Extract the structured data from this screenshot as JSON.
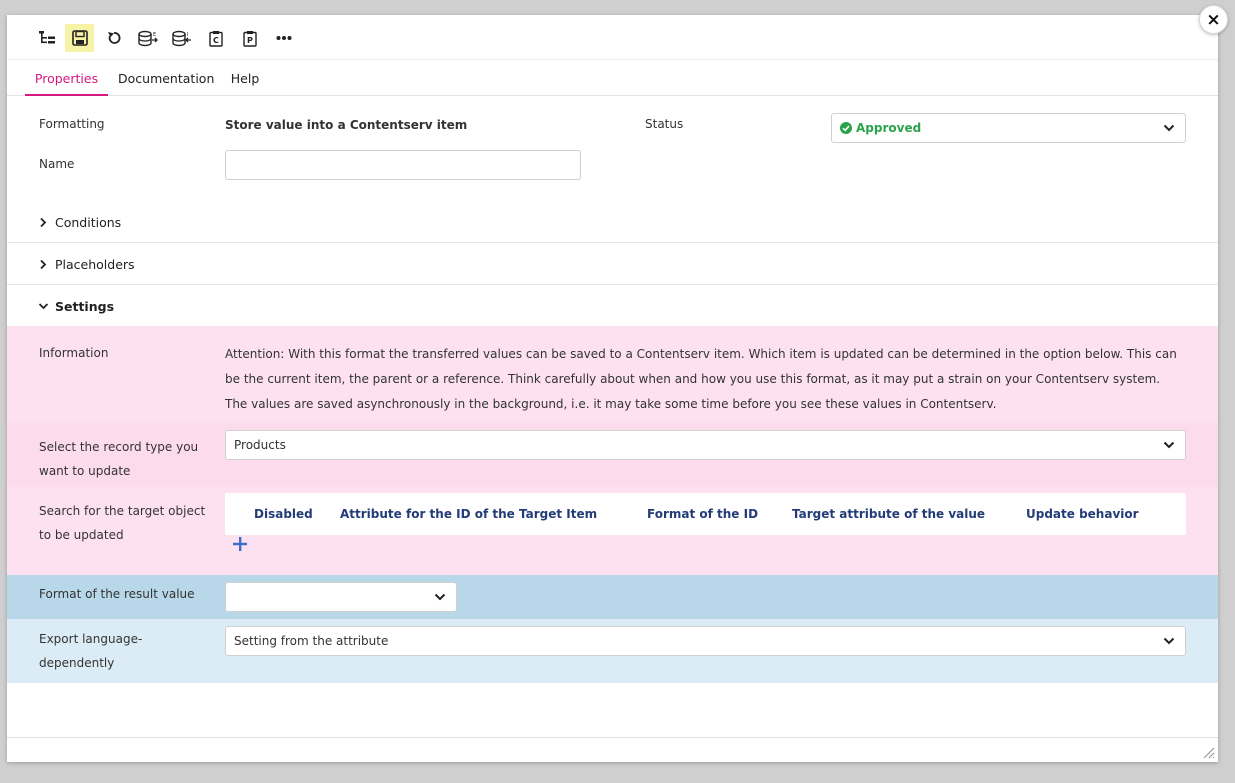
{
  "toolbar": {
    "buttons": [
      {
        "name": "tree-view-icon"
      },
      {
        "name": "save-icon",
        "active": true
      },
      {
        "name": "undo-icon"
      },
      {
        "name": "database-export-icon"
      },
      {
        "name": "database-import-icon"
      },
      {
        "name": "clipboard-c-icon"
      },
      {
        "name": "clipboard-p-icon"
      },
      {
        "name": "more-icon"
      }
    ]
  },
  "close_label": "×",
  "tabs": [
    {
      "label": "Properties",
      "active": true
    },
    {
      "label": "Documentation",
      "active": false
    },
    {
      "label": "Help",
      "active": false
    }
  ],
  "general": {
    "formatting_label": "Formatting",
    "formatting_value": "Store value into a Contentserv item",
    "status_label": "Status",
    "status_value": "Approved",
    "name_label": "Name",
    "name_value": ""
  },
  "sections": {
    "conditions": "Conditions",
    "placeholders": "Placeholders",
    "settings": "Settings"
  },
  "settings": {
    "information_label": "Information",
    "information_text": "Attention: With this format the transferred values can be saved to a Contentserv item. Which item is updated can be determined in the option below. This can be the current item, the parent or a reference. Think carefully about when and how you use this format, as it may put a strain on your Contentserv system. The values are saved asynchronously in the background, i.e. it may take some time before you see these values in Contentserv.",
    "record_type_label": "Select the record type you want to update",
    "record_type_value": "Products",
    "search_target_label": "Search for the target object to be updated",
    "table_headers": [
      "Disabled",
      "Attribute for the ID of the Target Item",
      "Format of the ID",
      "Target attribute of the value",
      "Update behavior"
    ],
    "format_result_label": "Format of the result value",
    "format_result_value": "",
    "export_language_label": "Export language-dependently",
    "export_language_value": "Setting from the attribute"
  },
  "colors": {
    "accent": "#d6177f",
    "approved": "#2aa34a",
    "table_header": "#233c78",
    "pink_band": "#fde1f0",
    "blue_band": "#b8d8ea"
  }
}
